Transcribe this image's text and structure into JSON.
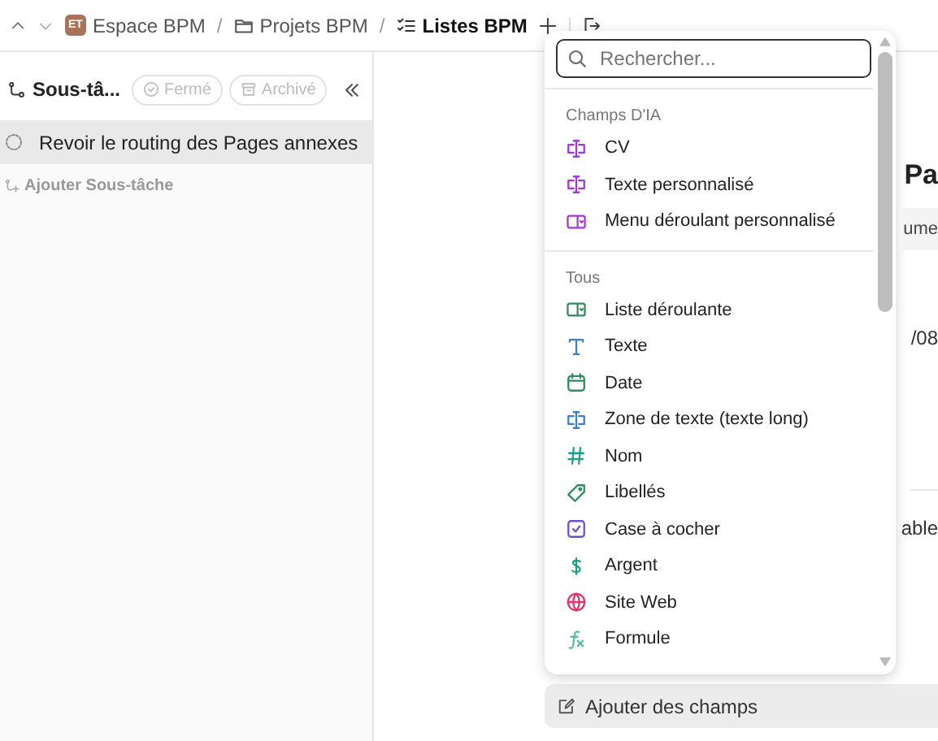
{
  "topbar": {
    "breadcrumbs": [
      {
        "kind": "space",
        "badge": "ET",
        "label": "Espace BPM"
      },
      {
        "kind": "folder",
        "label": "Projets BPM"
      },
      {
        "kind": "list",
        "label": "Listes BPM"
      }
    ],
    "separator": "/"
  },
  "sidebar": {
    "title": "Sous-tâ...",
    "filters": [
      {
        "kind": "closed",
        "label": "Fermé"
      },
      {
        "kind": "archived",
        "label": "Archivé"
      }
    ],
    "tasks": [
      {
        "label": "Revoir le routing des Pages annexes",
        "selected": true
      }
    ],
    "add_label": "Ajouter Sous-tâche"
  },
  "background": {
    "fragments": [
      "Pa",
      "ume",
      "/08",
      "able"
    ]
  },
  "field_menu": {
    "search": {
      "placeholder": "Rechercher..."
    },
    "sections": [
      {
        "title": "Champs D'IA",
        "items": [
          {
            "kind": "ai-text",
            "label": "CV",
            "color": "#a436e0"
          },
          {
            "kind": "ai-text",
            "label": "Texte personnalisé",
            "color": "#a436e0"
          },
          {
            "kind": "ai-dropdown",
            "label": "Menu déroulant personnalisé",
            "color": "#a436e0"
          }
        ]
      },
      {
        "title": "Tous",
        "items": [
          {
            "kind": "dropdown",
            "label": "Liste déroulante",
            "color": "#2f8a5c"
          },
          {
            "kind": "text",
            "label": "Texte",
            "color": "#3b7fd4"
          },
          {
            "kind": "date",
            "label": "Date",
            "color": "#2f8a5c"
          },
          {
            "kind": "textarea",
            "label": "Zone de texte (texte long)",
            "color": "#3b7fd4"
          },
          {
            "kind": "number",
            "label": "Nom",
            "color": "#1aa08a"
          },
          {
            "kind": "label",
            "label": "Libellés",
            "color": "#2f8a5c"
          },
          {
            "kind": "checkbox",
            "label": "Case à cocher",
            "color": "#6c4fd6"
          },
          {
            "kind": "money",
            "label": "Argent",
            "color": "#1aa08a"
          },
          {
            "kind": "web",
            "label": "Site Web",
            "color": "#e0356b"
          },
          {
            "kind": "formula",
            "label": "Formule",
            "color": "#5fb8a0"
          }
        ]
      }
    ]
  },
  "add_fields": {
    "label": "Ajouter des champs"
  }
}
